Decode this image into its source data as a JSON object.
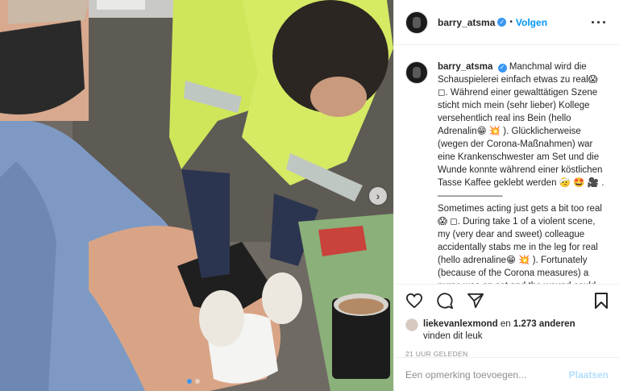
{
  "media": {
    "next_glyph": "›",
    "slides": 2,
    "active_slide": 0
  },
  "header": {
    "username": "barry_atsma",
    "verified_glyph": "✓",
    "separator": "•",
    "follow_label": "Volgen",
    "more_glyph": "···"
  },
  "caption": {
    "username": "barry_atsma",
    "lines": [
      "Manchmal wird die Schauspielerei einfach etwas zu real😱 ◻. Während einer gewalttätigen Szene sticht mich mein (sehr lieber) Kollege versehentlich real ins Bein (hello Adrenalin😁 💥 ). Glücklicherweise (wegen der Corona-Maßnahmen) war eine Krankenschwester am Set und die Wunde konnte während einer köstlichen Tasse Kaffee geklebt werden 🤕 🤩 🎥 .———————",
      "Sometimes acting just gets a bit too real😱 ◻. During take 1 of a violent scene, my (very dear and sweet) colleague accidentally stabs me in the leg for real (hello adrenaline😁 💥 ). Fortunately (because of the Corona measures) a nurse was on set and the wound could be taken care of during a"
    ]
  },
  "actions": {
    "icons": [
      "heart-icon",
      "comment-icon",
      "share-icon",
      "bookmark-icon"
    ]
  },
  "likes": {
    "first_liker": "liekevanlexmond",
    "connector": "en",
    "others": "1.273 anderen",
    "suffix": "vinden dit leuk"
  },
  "timestamp": "21 UUR GELEDEN",
  "add_comment": {
    "placeholder": "Een opmerking toevoegen...",
    "post_label": "Plaatsen"
  },
  "colors": {
    "accent": "#0095f6",
    "verified": "#3897f0",
    "post_disabled": "#b2dffc",
    "muted": "#8e8e8e"
  }
}
